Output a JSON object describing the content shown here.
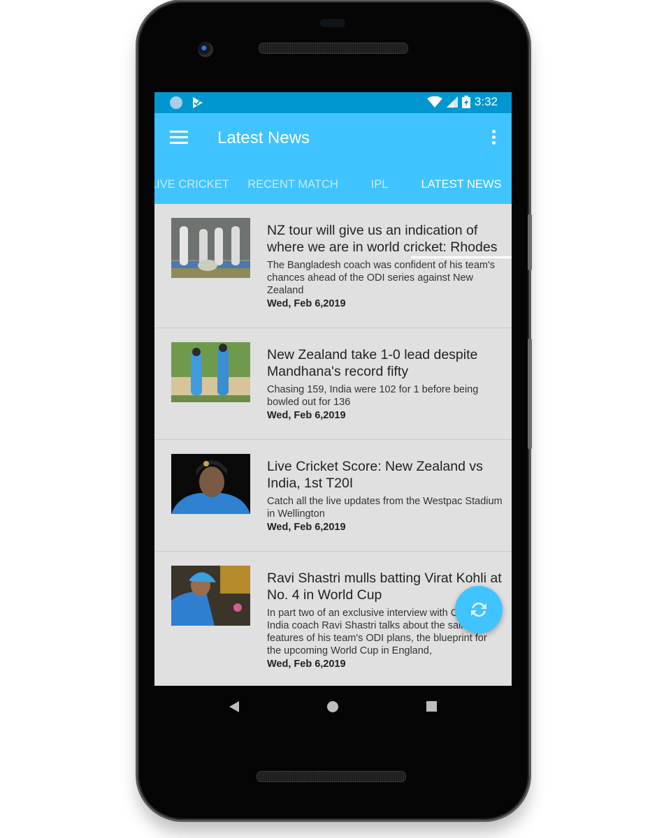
{
  "status_bar": {
    "time": "3:32",
    "left_icons": [
      "notification-circle-icon",
      "play-check-icon"
    ],
    "right_icons": [
      "wifi-icon",
      "signal-icon",
      "battery-charging-icon"
    ]
  },
  "app_bar": {
    "title": "Latest News",
    "menu_icon": "hamburger-menu-icon",
    "overflow_icon": "more-vertical-icon"
  },
  "tabs": [
    {
      "label": "LIVE CRICKET",
      "active": false
    },
    {
      "label": "RECENT MATCH",
      "active": false
    },
    {
      "label": "IPL",
      "active": false
    },
    {
      "label": "LATEST NEWS",
      "active": true
    }
  ],
  "news": [
    {
      "headline": "NZ tour will give us an indication of where we are in world cricket: Rhodes",
      "summary": "The Bangladesh coach was confident of his team's chances ahead of the ODI series against New Zealand",
      "date": "Wed, Feb 6,2019"
    },
    {
      "headline": "New Zealand take 1-0 lead despite Mandhana's record fifty",
      "summary": "Chasing 159, India were 102 for 1 before being bowled out for 136",
      "date": "Wed, Feb 6,2019"
    },
    {
      "headline": "Live Cricket Score: New Zealand vs India, 1st T20I",
      "summary": "Catch all the live updates from the Westpac Stadium in Wellington",
      "date": "Wed, Feb 6,2019"
    },
    {
      "headline": "Ravi Shastri mulls batting Virat Kohli at No. 4 in World Cup",
      "summary": "In part two of an exclusive interview with Cricbuzz, India coach Ravi Shastri talks about the salient features of his team's ODI plans, the blueprint for the upcoming World Cup in England,",
      "date": "Wed, Feb 6,2019"
    }
  ],
  "fab": {
    "icon": "refresh-icon"
  },
  "colors": {
    "status_bar": "#0097d1",
    "app_bar": "#40c4ff",
    "list_background": "#e0e0e0"
  }
}
